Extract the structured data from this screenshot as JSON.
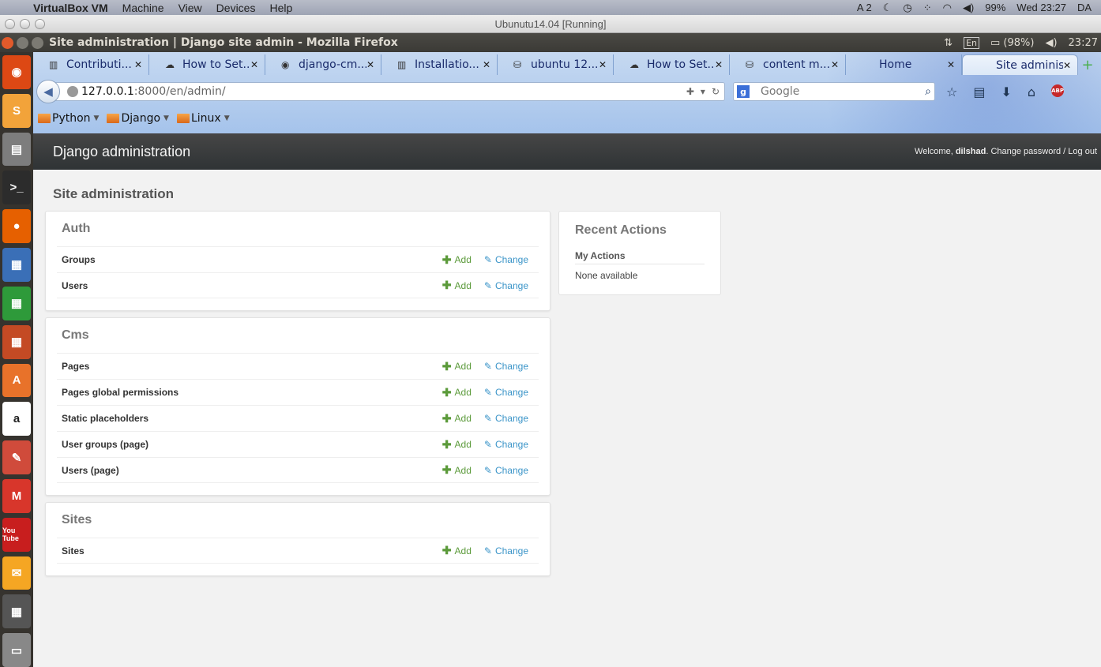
{
  "mac_menu": {
    "app": "VirtualBox VM",
    "items": [
      "Machine",
      "View",
      "Devices",
      "Help"
    ],
    "status": {
      "spaces": "2",
      "battery": "99%",
      "clock": "Wed 23:27",
      "user": "DA"
    }
  },
  "vbox_title": "Ubunutu14.04 [Running]",
  "ubuntu_panel": {
    "window_title": "Site administration | Django site admin - Mozilla Firefox",
    "lang": "En",
    "battery": "(98%)",
    "clock": "23:27"
  },
  "launcher_icons": [
    "ubuntu-icon",
    "sublime-icon",
    "files-icon",
    "terminal-icon",
    "firefox-icon",
    "writer-icon",
    "calc-icon",
    "impress-icon",
    "software-center-icon",
    "amazon-icon",
    "settings-icon",
    "gmail-icon",
    "youtube-icon",
    "mail-icon",
    "workspaces-icon",
    "drive-icon"
  ],
  "launcher_glyphs": [
    "◉",
    "S",
    "▤",
    ">_",
    "●",
    "▦",
    "▦",
    "▦",
    "A",
    "a",
    "✎",
    "M",
    "You Tube",
    "✉",
    "▦",
    "▭"
  ],
  "tabs": [
    {
      "label": "Contributi...",
      "icon": "▥"
    },
    {
      "label": "How to Set...",
      "icon": "☁"
    },
    {
      "label": "django-cm...",
      "icon": "◉"
    },
    {
      "label": "Installatio...",
      "icon": "▥"
    },
    {
      "label": "ubuntu 12....",
      "icon": "⛁"
    },
    {
      "label": "How to Set...",
      "icon": "☁"
    },
    {
      "label": "content m...",
      "icon": "⛁"
    },
    {
      "label": "Home",
      "icon": ""
    },
    {
      "label": "Site administr...",
      "icon": ""
    }
  ],
  "url": {
    "host": "127.0.0.1",
    "rest": ":8000/en/admin/"
  },
  "search": {
    "placeholder": "Google"
  },
  "bookmarks": [
    "Python",
    "Django",
    "Linux"
  ],
  "django": {
    "branding": "Django administration",
    "user_tools": {
      "welcome": "Welcome, ",
      "username": "dilshad",
      "change_password": "Change password",
      "separator": " / ",
      "logout": "Log out"
    },
    "page_title": "Site administration",
    "add_label": "Add",
    "change_label": "Change",
    "modules": [
      {
        "caption": "Auth",
        "rows": [
          "Groups",
          "Users"
        ]
      },
      {
        "caption": "Cms",
        "rows": [
          "Pages",
          "Pages global permissions",
          "Static placeholders",
          "User groups (page)",
          "Users (page)"
        ]
      },
      {
        "caption": "Sites",
        "rows": [
          "Sites"
        ]
      }
    ],
    "recent": {
      "caption": "Recent Actions",
      "subtitle": "My Actions",
      "empty": "None available"
    }
  }
}
